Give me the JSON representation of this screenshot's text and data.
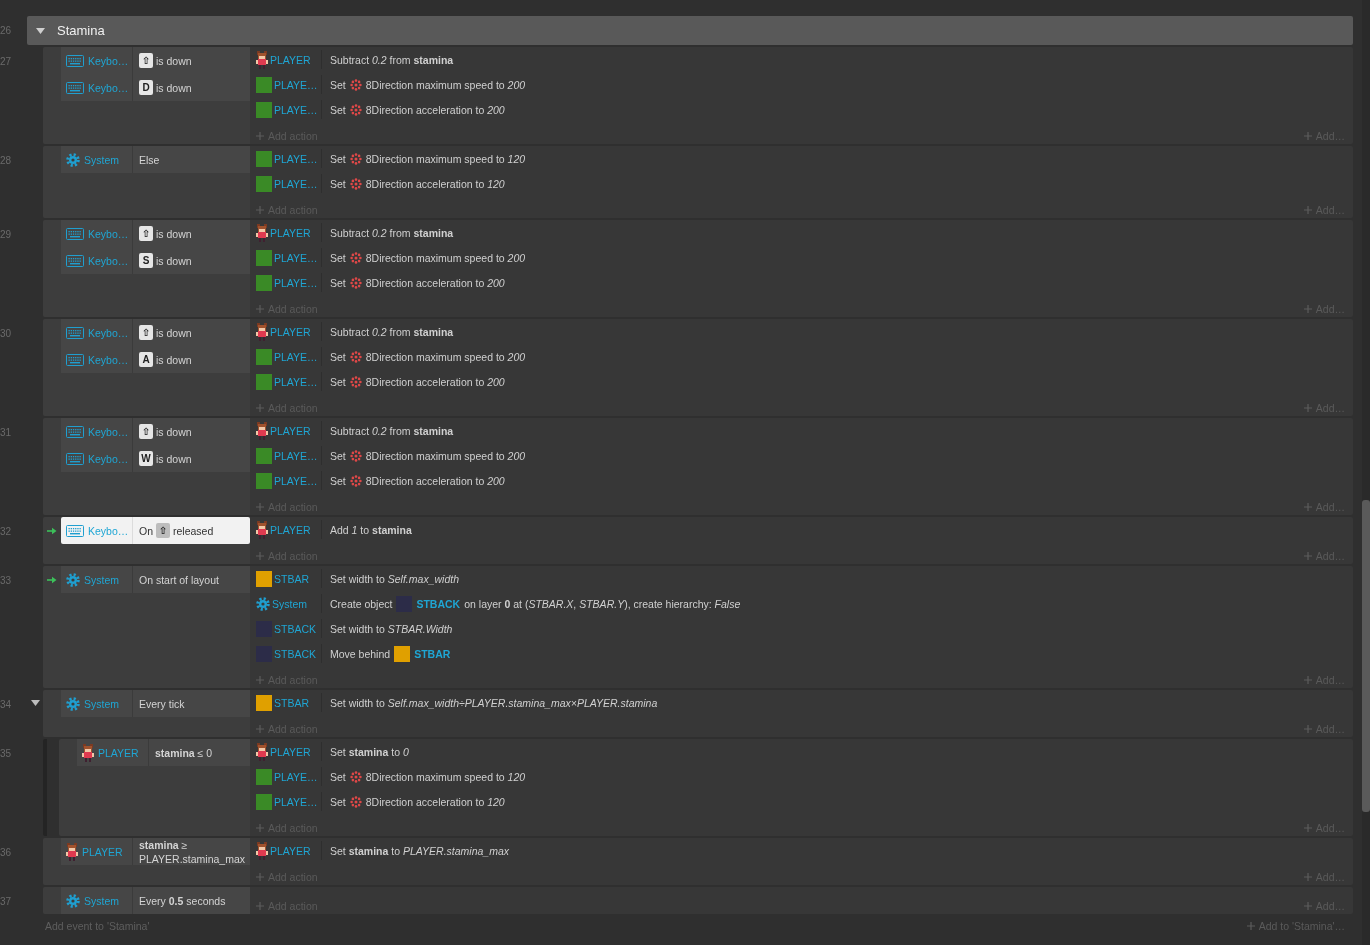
{
  "group": {
    "line": "26",
    "title": "Stamina",
    "expanded": true,
    "events": [
      {
        "line": "27",
        "trigger": false,
        "conditions": [
          {
            "selected": false,
            "object": {
              "kind": "keyboard",
              "name": "Keybo…"
            },
            "parts": [
              {
                "kind": "key",
                "text": "⇧"
              },
              {
                "kind": "text",
                "text": "is down"
              }
            ]
          },
          {
            "selected": false,
            "object": {
              "kind": "keyboard",
              "name": "Keybo…"
            },
            "parts": [
              {
                "kind": "key",
                "text": "D"
              },
              {
                "kind": "text",
                "text": "is down"
              }
            ]
          }
        ],
        "actions": [
          {
            "object": {
              "kind": "sprite",
              "name": "PLAYER"
            },
            "parts": [
              {
                "kind": "text",
                "text": "Subtract *0.2* from **stamina**"
              }
            ]
          },
          {
            "object": {
              "kind": "swatch",
              "color": "#3a8a26",
              "name": "PLAYE…"
            },
            "parts": [
              {
                "kind": "text",
                "text": "Set"
              },
              {
                "kind": "behavior"
              },
              {
                "kind": "text",
                "text": "8Direction maximum speed to *200*"
              }
            ]
          },
          {
            "object": {
              "kind": "swatch",
              "color": "#3a8a26",
              "name": "PLAYE…"
            },
            "parts": [
              {
                "kind": "text",
                "text": "Set"
              },
              {
                "kind": "behavior"
              },
              {
                "kind": "text",
                "text": "8Direction acceleration to *200*"
              }
            ]
          }
        ],
        "add_action": "Add action",
        "add": "Add…"
      },
      {
        "line": "28",
        "trigger": false,
        "conditions": [
          {
            "selected": false,
            "object": {
              "kind": "system",
              "name": "System"
            },
            "parts": [
              {
                "kind": "text",
                "text": "Else"
              }
            ]
          }
        ],
        "actions": [
          {
            "object": {
              "kind": "swatch",
              "color": "#3a8a26",
              "name": "PLAYE…"
            },
            "parts": [
              {
                "kind": "text",
                "text": "Set"
              },
              {
                "kind": "behavior"
              },
              {
                "kind": "text",
                "text": "8Direction maximum speed to *120*"
              }
            ]
          },
          {
            "object": {
              "kind": "swatch",
              "color": "#3a8a26",
              "name": "PLAYE…"
            },
            "parts": [
              {
                "kind": "text",
                "text": "Set"
              },
              {
                "kind": "behavior"
              },
              {
                "kind": "text",
                "text": "8Direction acceleration to *120*"
              }
            ]
          }
        ],
        "add_action": "Add action",
        "add": "Add…"
      },
      {
        "line": "29",
        "trigger": false,
        "conditions": [
          {
            "selected": false,
            "object": {
              "kind": "keyboard",
              "name": "Keybo…"
            },
            "parts": [
              {
                "kind": "key",
                "text": "⇧"
              },
              {
                "kind": "text",
                "text": "is down"
              }
            ]
          },
          {
            "selected": false,
            "object": {
              "kind": "keyboard",
              "name": "Keybo…"
            },
            "parts": [
              {
                "kind": "key",
                "text": "S"
              },
              {
                "kind": "text",
                "text": "is down"
              }
            ]
          }
        ],
        "actions": [
          {
            "object": {
              "kind": "sprite",
              "name": "PLAYER"
            },
            "parts": [
              {
                "kind": "text",
                "text": "Subtract *0.2* from **stamina**"
              }
            ]
          },
          {
            "object": {
              "kind": "swatch",
              "color": "#3a8a26",
              "name": "PLAYE…"
            },
            "parts": [
              {
                "kind": "text",
                "text": "Set"
              },
              {
                "kind": "behavior"
              },
              {
                "kind": "text",
                "text": "8Direction maximum speed to *200*"
              }
            ]
          },
          {
            "object": {
              "kind": "swatch",
              "color": "#3a8a26",
              "name": "PLAYE…"
            },
            "parts": [
              {
                "kind": "text",
                "text": "Set"
              },
              {
                "kind": "behavior"
              },
              {
                "kind": "text",
                "text": "8Direction acceleration to *200*"
              }
            ]
          }
        ],
        "add_action": "Add action",
        "add": "Add…"
      },
      {
        "line": "30",
        "trigger": false,
        "conditions": [
          {
            "selected": false,
            "object": {
              "kind": "keyboard",
              "name": "Keybo…"
            },
            "parts": [
              {
                "kind": "key",
                "text": "⇧"
              },
              {
                "kind": "text",
                "text": "is down"
              }
            ]
          },
          {
            "selected": false,
            "object": {
              "kind": "keyboard",
              "name": "Keybo…"
            },
            "parts": [
              {
                "kind": "key",
                "text": "A"
              },
              {
                "kind": "text",
                "text": "is down"
              }
            ]
          }
        ],
        "actions": [
          {
            "object": {
              "kind": "sprite",
              "name": "PLAYER"
            },
            "parts": [
              {
                "kind": "text",
                "text": "Subtract *0.2* from **stamina**"
              }
            ]
          },
          {
            "object": {
              "kind": "swatch",
              "color": "#3a8a26",
              "name": "PLAYE…"
            },
            "parts": [
              {
                "kind": "text",
                "text": "Set"
              },
              {
                "kind": "behavior"
              },
              {
                "kind": "text",
                "text": "8Direction maximum speed to *200*"
              }
            ]
          },
          {
            "object": {
              "kind": "swatch",
              "color": "#3a8a26",
              "name": "PLAYE…"
            },
            "parts": [
              {
                "kind": "text",
                "text": "Set"
              },
              {
                "kind": "behavior"
              },
              {
                "kind": "text",
                "text": "8Direction acceleration to *200*"
              }
            ]
          }
        ],
        "add_action": "Add action",
        "add": "Add…"
      },
      {
        "line": "31",
        "trigger": false,
        "conditions": [
          {
            "selected": false,
            "object": {
              "kind": "keyboard",
              "name": "Keybo…"
            },
            "parts": [
              {
                "kind": "key",
                "text": "⇧"
              },
              {
                "kind": "text",
                "text": "is down"
              }
            ]
          },
          {
            "selected": false,
            "object": {
              "kind": "keyboard",
              "name": "Keybo…"
            },
            "parts": [
              {
                "kind": "key",
                "text": "W"
              },
              {
                "kind": "text",
                "text": "is down"
              }
            ]
          }
        ],
        "actions": [
          {
            "object": {
              "kind": "sprite",
              "name": "PLAYER"
            },
            "parts": [
              {
                "kind": "text",
                "text": "Subtract *0.2* from **stamina**"
              }
            ]
          },
          {
            "object": {
              "kind": "swatch",
              "color": "#3a8a26",
              "name": "PLAYE…"
            },
            "parts": [
              {
                "kind": "text",
                "text": "Set"
              },
              {
                "kind": "behavior"
              },
              {
                "kind": "text",
                "text": "8Direction maximum speed to *200*"
              }
            ]
          },
          {
            "object": {
              "kind": "swatch",
              "color": "#3a8a26",
              "name": "PLAYE…"
            },
            "parts": [
              {
                "kind": "text",
                "text": "Set"
              },
              {
                "kind": "behavior"
              },
              {
                "kind": "text",
                "text": "8Direction acceleration to *200*"
              }
            ]
          }
        ],
        "add_action": "Add action",
        "add": "Add…"
      },
      {
        "line": "32",
        "trigger": true,
        "conditions": [
          {
            "selected": true,
            "object": {
              "kind": "keyboard",
              "name": "Keybo…"
            },
            "parts": [
              {
                "kind": "text",
                "text": "On"
              },
              {
                "kind": "key",
                "text": "⇧"
              },
              {
                "kind": "text",
                "text": "released"
              }
            ]
          }
        ],
        "actions": [
          {
            "object": {
              "kind": "sprite",
              "name": "PLAYER"
            },
            "parts": [
              {
                "kind": "text",
                "text": "Add *1* to **stamina**"
              }
            ]
          }
        ],
        "add_action": "Add action",
        "add": "Add…"
      },
      {
        "line": "33",
        "trigger": true,
        "conditions": [
          {
            "selected": false,
            "object": {
              "kind": "system",
              "name": "System"
            },
            "parts": [
              {
                "kind": "text",
                "text": "On start of layout"
              }
            ]
          }
        ],
        "actions": [
          {
            "object": {
              "kind": "swatch",
              "color": "#e0a000",
              "name": "STBAR"
            },
            "parts": [
              {
                "kind": "text",
                "text": "Set width to *Self.max_width*"
              }
            ]
          },
          {
            "object": {
              "kind": "system",
              "name": "System"
            },
            "parts": [
              {
                "kind": "text",
                "text": "Create object"
              },
              {
                "kind": "object",
                "color": "#2c2c48",
                "name": "STBACK"
              },
              {
                "kind": "text",
                "text": "on layer **0** at (*STBAR.X*, *STBAR.Y*), create hierarchy: *False*"
              }
            ]
          },
          {
            "object": {
              "kind": "swatch",
              "color": "#2c2c48",
              "name": "STBACK"
            },
            "parts": [
              {
                "kind": "text",
                "text": "Set width to *STBAR.Width*"
              }
            ]
          },
          {
            "object": {
              "kind": "swatch",
              "color": "#2c2c48",
              "name": "STBACK"
            },
            "parts": [
              {
                "kind": "text",
                "text": "Move behind"
              },
              {
                "kind": "object",
                "color": "#e0a000",
                "name": "STBAR"
              }
            ]
          }
        ],
        "add_action": "Add action",
        "add": "Add…"
      },
      {
        "line": "34",
        "trigger": false,
        "expanded": true,
        "conditions": [
          {
            "selected": false,
            "object": {
              "kind": "system",
              "name": "System"
            },
            "parts": [
              {
                "kind": "text",
                "text": "Every tick"
              }
            ]
          }
        ],
        "actions": [
          {
            "object": {
              "kind": "swatch",
              "color": "#e0a000",
              "name": "STBAR"
            },
            "parts": [
              {
                "kind": "text",
                "text": "Set width to *Self.max_width÷PLAYER.stamina_max×PLAYER.stamina*"
              }
            ]
          }
        ],
        "add_action": "Add action",
        "add": "Add…",
        "children": [
          {
            "line": "35",
            "trigger": false,
            "conditions": [
              {
                "selected": false,
                "object": {
                  "kind": "sprite",
                  "name": "PLAYER"
                },
                "parts": [
                  {
                    "kind": "text",
                    "text": "**stamina** ≤ 0"
                  }
                ]
              }
            ],
            "actions": [
              {
                "object": {
                  "kind": "sprite",
                  "name": "PLAYER"
                },
                "parts": [
                  {
                    "kind": "text",
                    "text": "Set **stamina** to *0*"
                  }
                ]
              },
              {
                "object": {
                  "kind": "swatch",
                  "color": "#3a8a26",
                  "name": "PLAYE…"
                },
                "parts": [
                  {
                    "kind": "text",
                    "text": "Set"
                  },
                  {
                    "kind": "behavior"
                  },
                  {
                    "kind": "text",
                    "text": "8Direction maximum speed to *120*"
                  }
                ]
              },
              {
                "object": {
                  "kind": "swatch",
                  "color": "#3a8a26",
                  "name": "PLAYE…"
                },
                "parts": [
                  {
                    "kind": "text",
                    "text": "Set"
                  },
                  {
                    "kind": "behavior"
                  },
                  {
                    "kind": "text",
                    "text": "8Direction acceleration to *120*"
                  }
                ]
              }
            ],
            "add_action": "Add action",
            "add": "Add…"
          }
        ]
      },
      {
        "line": "36",
        "trigger": false,
        "conditions": [
          {
            "selected": false,
            "object": {
              "kind": "sprite",
              "name": "PLAYER"
            },
            "parts": [
              {
                "kind": "text",
                "text": "**stamina** ≥ PLAYER.stamina_max"
              }
            ]
          }
        ],
        "actions": [
          {
            "object": {
              "kind": "sprite",
              "name": "PLAYER"
            },
            "parts": [
              {
                "kind": "text",
                "text": "Set **stamina** to *PLAYER.stamina_max*"
              }
            ]
          }
        ],
        "add_action": "Add action",
        "add": "Add…"
      },
      {
        "line": "37",
        "trigger": false,
        "conditions": [
          {
            "selected": false,
            "object": {
              "kind": "system",
              "name": "System"
            },
            "parts": [
              {
                "kind": "text",
                "text": "Every **0.5** seconds"
              }
            ]
          }
        ],
        "add_action": "Add action",
        "add": "Add…"
      }
    ]
  },
  "footer": {
    "add_event": "Add event to 'Stamina'",
    "add_to": "Add to 'Stamina'…"
  }
}
